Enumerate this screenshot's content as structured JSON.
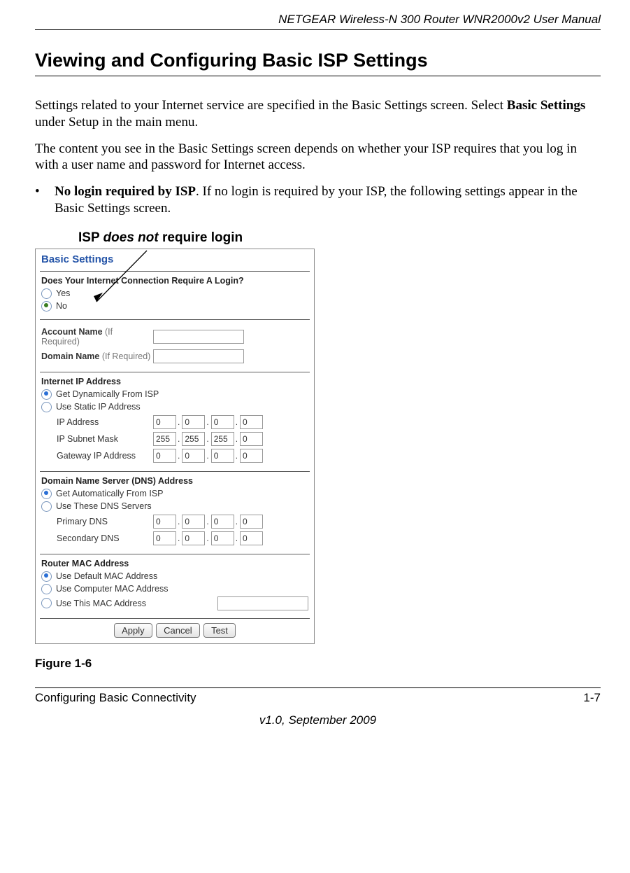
{
  "header": {
    "running_title": "NETGEAR Wireless-N 300 Router WNR2000v2 User Manual"
  },
  "section": {
    "heading": "Viewing and Configuring Basic ISP Settings"
  },
  "paras": {
    "p1a": "Settings related to your Internet service are specified in the Basic Settings screen. Select ",
    "p1b_bold": "Basic Settings",
    "p1c": " under Setup in the main menu.",
    "p2": "The content you see in the Basic Settings screen depends on whether your ISP requires that you log in with a user name and password for Internet access.",
    "bul_dot": "•",
    "bul1_bold": "No login required by ISP",
    "bul1_rest": ". If no login is required by your ISP, the following settings appear in the Basic Settings screen."
  },
  "callout": {
    "pre": "ISP ",
    "em": "does not",
    "post": " require login"
  },
  "panel": {
    "title": "Basic Settings",
    "login_q": "Does Your Internet Connection Require A Login?",
    "yes": "Yes",
    "no": "No",
    "account_name_label": "Account Name",
    "domain_name_label": "Domain Name",
    "if_required": " (If Required)",
    "iip_head": "Internet IP Address",
    "iip_dyn": "Get Dynamically From ISP",
    "iip_static": "Use Static IP Address",
    "ip_address": "IP Address",
    "subnet": "IP Subnet Mask",
    "gateway": "Gateway IP Address",
    "ip_vals": [
      "0",
      "0",
      "0",
      "0"
    ],
    "subnet_vals": [
      "255",
      "255",
      "255",
      "0"
    ],
    "gateway_vals": [
      "0",
      "0",
      "0",
      "0"
    ],
    "dns_head": "Domain Name Server (DNS) Address",
    "dns_auto": "Get Automatically From ISP",
    "dns_use": "Use These DNS Servers",
    "primary_dns": "Primary DNS",
    "secondary_dns": "Secondary DNS",
    "pdns_vals": [
      "0",
      "0",
      "0",
      "0"
    ],
    "sdns_vals": [
      "0",
      "0",
      "0",
      "0"
    ],
    "mac_head": "Router MAC Address",
    "mac_default": "Use Default MAC Address",
    "mac_computer": "Use Computer MAC Address",
    "mac_this": "Use This MAC Address",
    "btn_apply": "Apply",
    "btn_cancel": "Cancel",
    "btn_test": "Test"
  },
  "figure": {
    "caption": "Figure 1-6"
  },
  "footer": {
    "chapter": "Configuring Basic Connectivity",
    "pagenum": "1-7",
    "version": "v1.0, September 2009"
  }
}
